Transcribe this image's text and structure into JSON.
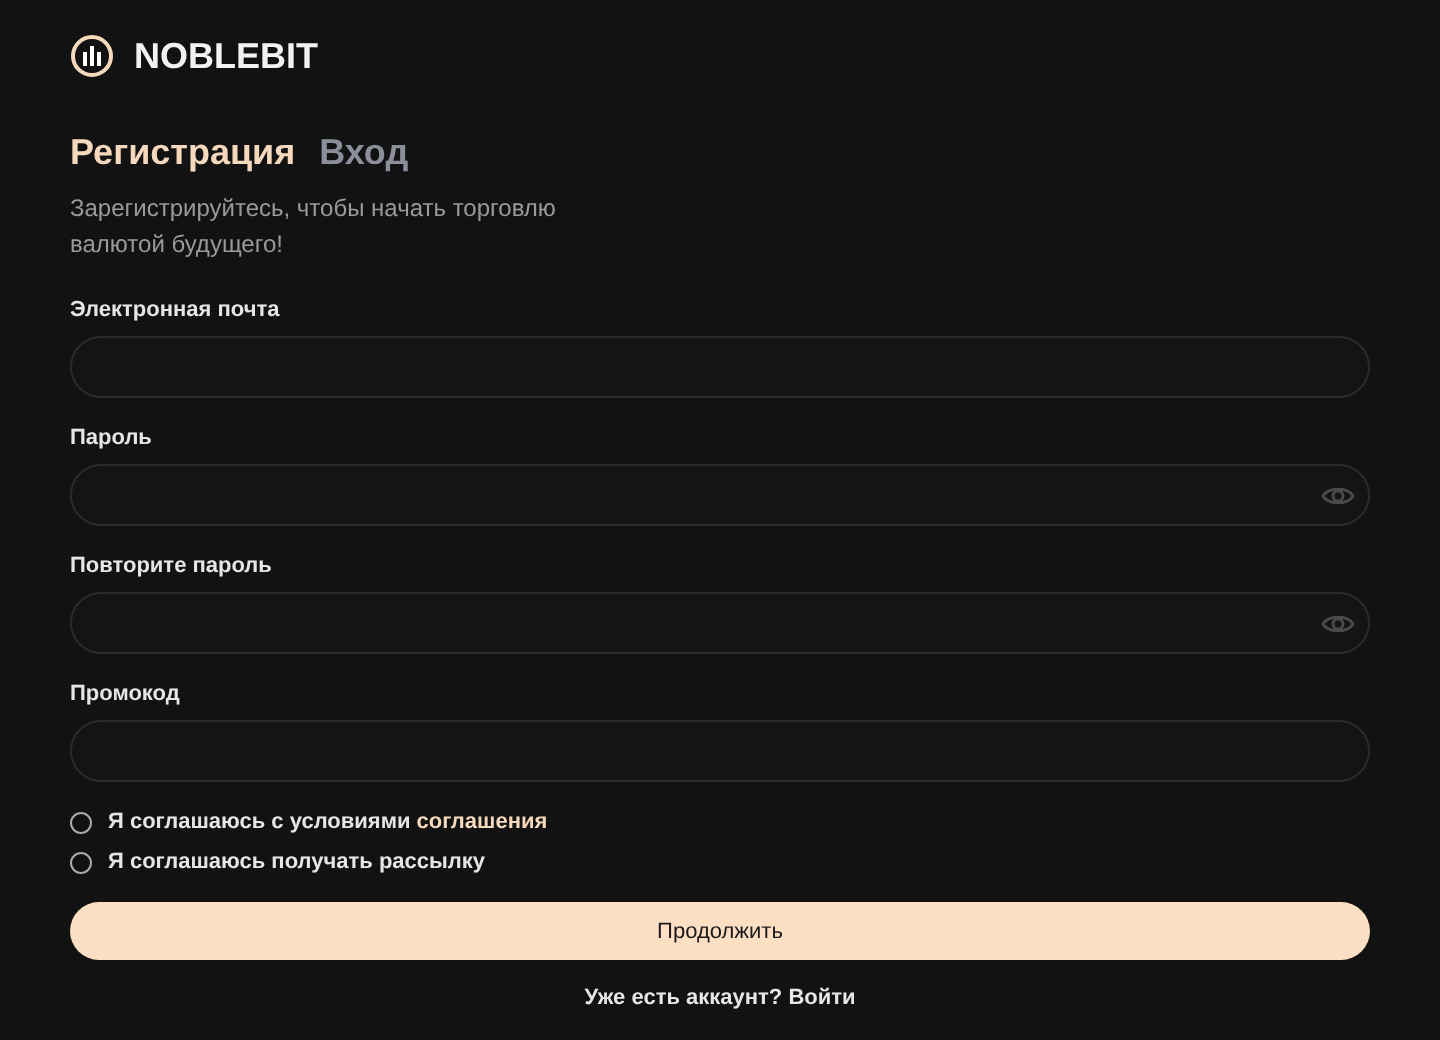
{
  "brand": {
    "name": "NOBLEBIT"
  },
  "tabs": [
    {
      "label": "Регистрация",
      "selected": true
    },
    {
      "label": "Вход",
      "selected": false
    }
  ],
  "subtitle": "Зарегистрируйтесь, чтобы начать торговлю валютой будущего!",
  "fields": [
    {
      "label": "Электронная почта",
      "kind": "text"
    },
    {
      "label": "Пароль",
      "kind": "password"
    },
    {
      "label": "Повторите пароль",
      "kind": "password"
    },
    {
      "label": "Промокод",
      "kind": "text"
    }
  ],
  "checkboxes": [
    {
      "text": "Я соглашаюсь с условиями ",
      "link": "соглашения",
      "checked": false
    },
    {
      "text": "Я соглашаюсь получать рассылку",
      "checked": false
    }
  ],
  "submit": "Продолжить",
  "footer": "Уже есть аккаунт? Войти"
}
